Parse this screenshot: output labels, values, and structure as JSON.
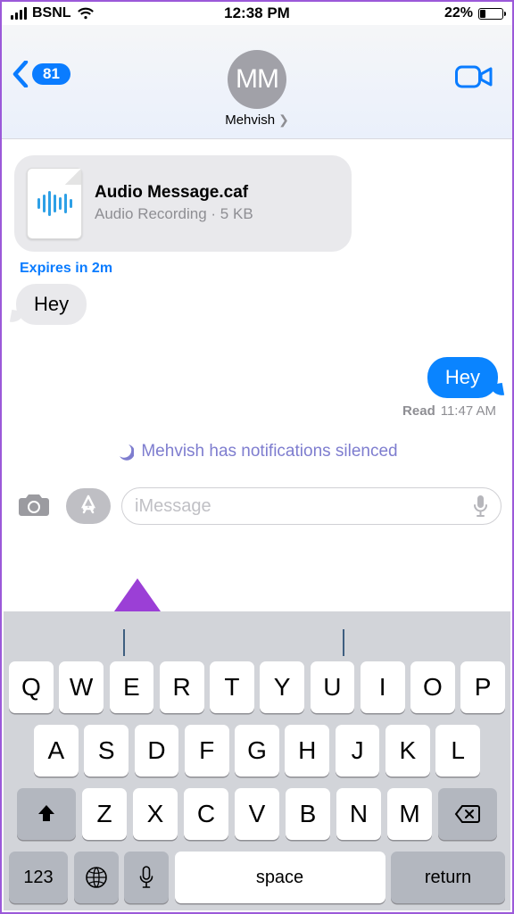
{
  "status": {
    "carrier": "BSNL",
    "time": "12:38 PM",
    "battery_pct": "22%"
  },
  "header": {
    "back_count": "81",
    "avatar_initials": "MM",
    "contact_name": "Mehvish"
  },
  "messages": {
    "audio": {
      "title": "Audio Message.caf",
      "subtitle": "Audio Recording · 5 KB"
    },
    "expiry": "Expires in 2m",
    "received1": "Hey",
    "sent1": "Hey",
    "read_label": "Read",
    "read_time": "11:47 AM",
    "silenced": "Mehvish has notifications silenced"
  },
  "compose": {
    "placeholder": "iMessage"
  },
  "keyboard": {
    "row1": [
      "Q",
      "W",
      "E",
      "R",
      "T",
      "Y",
      "U",
      "I",
      "O",
      "P"
    ],
    "row2": [
      "A",
      "S",
      "D",
      "F",
      "G",
      "H",
      "J",
      "K",
      "L"
    ],
    "row3": [
      "Z",
      "X",
      "C",
      "V",
      "B",
      "N",
      "M"
    ],
    "numbers": "123",
    "space": "space",
    "return": "return"
  }
}
